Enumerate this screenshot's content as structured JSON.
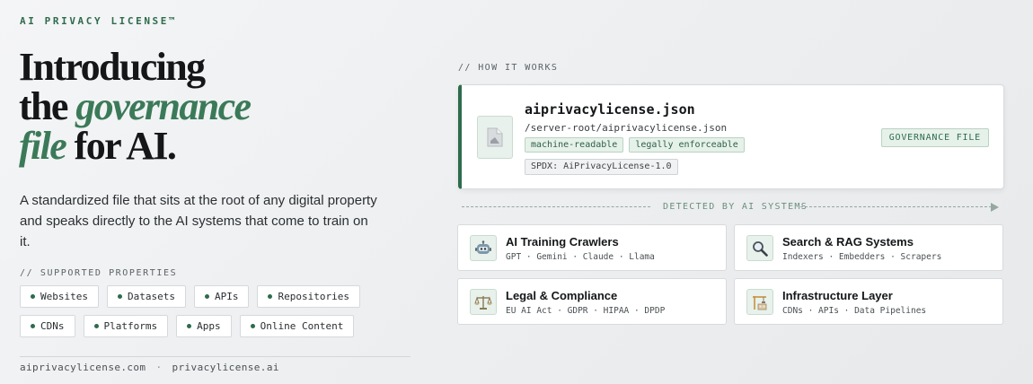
{
  "brand": "AI PRIVACY LICENSE™",
  "hero": {
    "line1": "Introducing",
    "line2_prefix": "the",
    "line2_em": "governance",
    "line3_em": "file",
    "line3_rest": "for AI.",
    "subtitle": "A standardized file that sits at the root of any digital property and speaks directly to the AI systems that come to train on it."
  },
  "supported": {
    "label": "// SUPPORTED PROPERTIES",
    "items": [
      "Websites",
      "Datasets",
      "APIs",
      "Repositories",
      "CDNs",
      "Platforms",
      "Apps",
      "Online Content"
    ]
  },
  "footer": {
    "domain1": "aiprivacylicense.com",
    "separator": "·",
    "domain2": "privacylicense.ai"
  },
  "how": {
    "label": "// HOW IT WORKS",
    "file": {
      "icon": "document-icon",
      "name": "aiprivacylicense.json",
      "path": "/server-root/aiprivacylicense.json",
      "tags": [
        "machine-readable",
        "legally enforceable"
      ],
      "spdx": "SPDX: AiPrivacyLicense-1.0",
      "badge": "GOVERNANCE FILE"
    },
    "detected_label": "DETECTED BY AI SYSTEMS",
    "systems": [
      {
        "icon": "robot-icon",
        "title": "AI Training Crawlers",
        "desc": "GPT · Gemini · Claude · Llama"
      },
      {
        "icon": "magnifier-icon",
        "title": "Search & RAG Systems",
        "desc": "Indexers · Embedders · Scrapers"
      },
      {
        "icon": "scales-icon",
        "title": "Legal & Compliance",
        "desc": "EU AI Act · GDPR · HIPAA · DPDP"
      },
      {
        "icon": "building-icon",
        "title": "Infrastructure Layer",
        "desc": "CDNs · APIs · Data Pipelines"
      }
    ]
  },
  "colors": {
    "accent": "#2e6b4d",
    "accent_italic": "#3b7a59",
    "tag_bg": "#e6f1ea"
  }
}
